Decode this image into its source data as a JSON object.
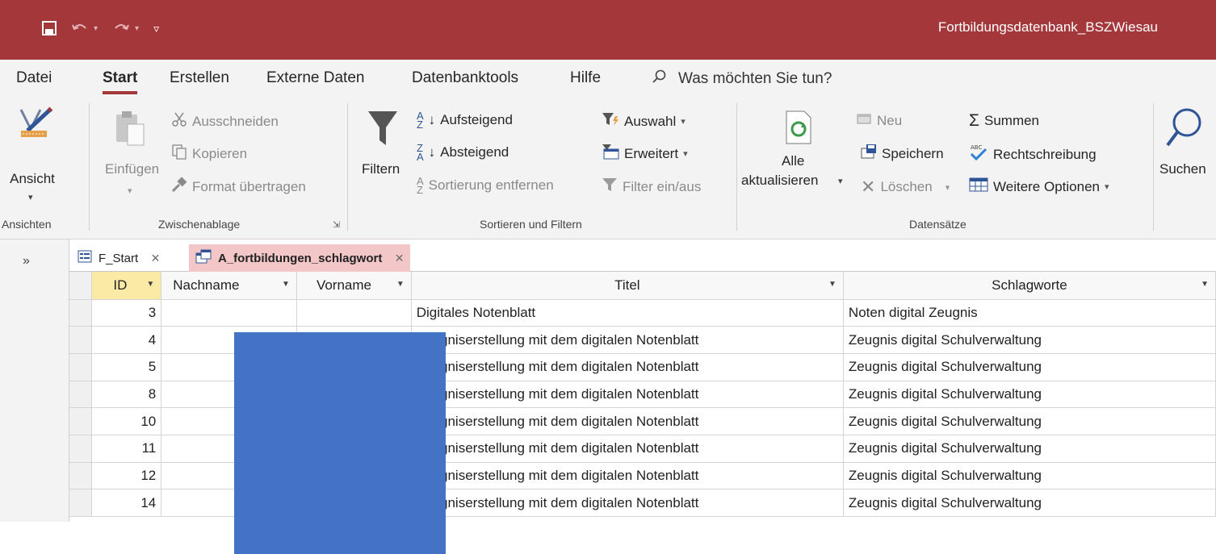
{
  "window": {
    "title": "Fortbildungsdatenbank_BSZWiesau"
  },
  "tabs": [
    {
      "label": "Datei"
    },
    {
      "label": "Start"
    },
    {
      "label": "Erstellen"
    },
    {
      "label": "Externe Daten"
    },
    {
      "label": "Datenbanktools"
    },
    {
      "label": "Hilfe"
    }
  ],
  "tellme": "Was möchten Sie tun?",
  "ribbon": {
    "ansichten": {
      "button": "Ansicht",
      "group": "Ansichten"
    },
    "zwischenablage": {
      "paste": "Einfügen",
      "cut": "Ausschneiden",
      "copy": "Kopieren",
      "format": "Format übertragen",
      "group": "Zwischenablage"
    },
    "sortieren": {
      "filter": "Filtern",
      "asc": "Aufsteigend",
      "desc": "Absteigend",
      "remove_sort": "Sortierung entfernen",
      "selection": "Auswahl",
      "advanced": "Erweitert",
      "toggle_filter": "Filter ein/aus",
      "group": "Sortieren und Filtern"
    },
    "datensaetze": {
      "refresh_1": "Alle",
      "refresh_2": "aktualisieren",
      "new": "Neu",
      "save": "Speichern",
      "delete": "Löschen",
      "totals": "Summen",
      "spelling": "Rechtschreibung",
      "more": "Weitere Optionen",
      "group": "Datensätze"
    },
    "suchen": {
      "button": "Suchen"
    }
  },
  "document_tabs": [
    {
      "label": "F_Start"
    },
    {
      "label": "A_fortbildungen_schlagwort"
    }
  ],
  "datasheet": {
    "columns": [
      "ID",
      "Nachname",
      "Vorname",
      "Titel",
      "Schlagworte"
    ],
    "rows": [
      {
        "id": "3",
        "titel": "Digitales Notenblatt",
        "schlagworte": "Noten digital Zeugnis"
      },
      {
        "id": "4",
        "titel": "Zeugniserstellung mit dem digitalen Notenblatt",
        "schlagworte": "Zeugnis digital Schulverwaltung"
      },
      {
        "id": "5",
        "titel": "Zeugniserstellung mit dem digitalen Notenblatt",
        "schlagworte": "Zeugnis digital Schulverwaltung"
      },
      {
        "id": "8",
        "titel": "Zeugniserstellung mit dem digitalen Notenblatt",
        "schlagworte": "Zeugnis digital Schulverwaltung"
      },
      {
        "id": "10",
        "titel": "Zeugniserstellung mit dem digitalen Notenblatt",
        "schlagworte": "Zeugnis digital Schulverwaltung"
      },
      {
        "id": "11",
        "titel": "Zeugniserstellung mit dem digitalen Notenblatt",
        "schlagworte": "Zeugnis digital Schulverwaltung"
      },
      {
        "id": "12",
        "titel": "Zeugniserstellung mit dem digitalen Notenblatt",
        "schlagworte": "Zeugnis digital Schulverwaltung"
      },
      {
        "id": "14",
        "titel": "Zeugniserstellung mit dem digitalen Notenblatt",
        "schlagworte": "Zeugnis digital Schulverwaltung"
      }
    ]
  },
  "colors": {
    "accent": "#a4373a",
    "redaction": "#4472c4",
    "active_tab": "#f3c7c8",
    "id_header": "#fbe9a6"
  }
}
